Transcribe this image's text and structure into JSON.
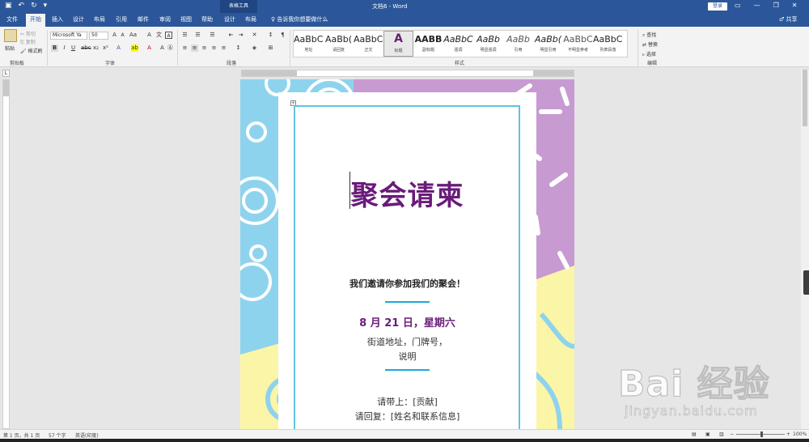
{
  "titlebar": {
    "context_tab": "表格工具",
    "doc_title": "文档6 - Word",
    "login": "登录",
    "qat": [
      "save-icon",
      "undo-icon",
      "redo-icon",
      "customize-icon"
    ],
    "qat_glyphs": [
      "▣",
      "↶",
      "↻",
      "▾"
    ],
    "win_glyphs": [
      "▭",
      "—",
      "❐",
      "✕"
    ]
  },
  "tabs": [
    "文件",
    "开始",
    "插入",
    "设计",
    "布局",
    "引用",
    "邮件",
    "审阅",
    "视图",
    "帮助",
    "设计",
    "布局"
  ],
  "active_tab_index": 1,
  "tellme": "♀ 告诉我你想要做什么",
  "share": "♂ 共享",
  "ribbon": {
    "clipboard": {
      "paste": "粘贴",
      "cut": "剪切",
      "copy": "复制",
      "painter": "格式刷",
      "label": "剪贴板"
    },
    "font": {
      "family": "Microsoft Ya",
      "size": "50",
      "label": "字体"
    },
    "paragraph": {
      "label": "段落"
    },
    "styles_label": "样式",
    "editing": {
      "find": "查找",
      "replace": "替换",
      "select": "选择",
      "label": "编辑"
    }
  },
  "styles": [
    {
      "preview": "AaBbC(",
      "name": "地址"
    },
    {
      "preview": "AaBb(",
      "name": "请回复"
    },
    {
      "preview": "AaBbC(",
      "name": "正文"
    },
    {
      "preview": "A",
      "name": "标题"
    },
    {
      "preview": "AABB",
      "name": "副标题"
    },
    {
      "preview": "AaBbC",
      "name": "强调"
    },
    {
      "preview": "AaBb",
      "name": "明显强调"
    },
    {
      "preview": "AaBb",
      "name": "引用"
    },
    {
      "preview": "AaBb(",
      "name": "明显引用"
    },
    {
      "preview": "AaBbC",
      "name": "不明显参考"
    },
    {
      "preview": "AaBbC(",
      "name": "列表段落"
    }
  ],
  "document": {
    "title": "聚会请柬",
    "invite": "我们邀请你参加我们的聚会！",
    "date": "8 月 21 日，星期六",
    "address_line1": "街道地址，门牌号，",
    "address_line2": "说明",
    "bring": "请带上：[贡献]",
    "rsvp": "请回复：[姓名和联系信息]"
  },
  "status": {
    "page": "第 1 页，共 1 页",
    "words": "57 个字",
    "language": "英语(印度)",
    "zoom": "100%"
  },
  "colors": {
    "word_blue": "#2b579a",
    "title_purple": "#6a1b7a",
    "frame_cyan": "#5fc3dd",
    "bg_blue": "#8ed3ee",
    "bg_purple": "#c79ad1",
    "bg_yellow": "#fbf5a8"
  },
  "watermark": {
    "brand": "Bai 经验",
    "url": "jingyan.baidu.com"
  }
}
